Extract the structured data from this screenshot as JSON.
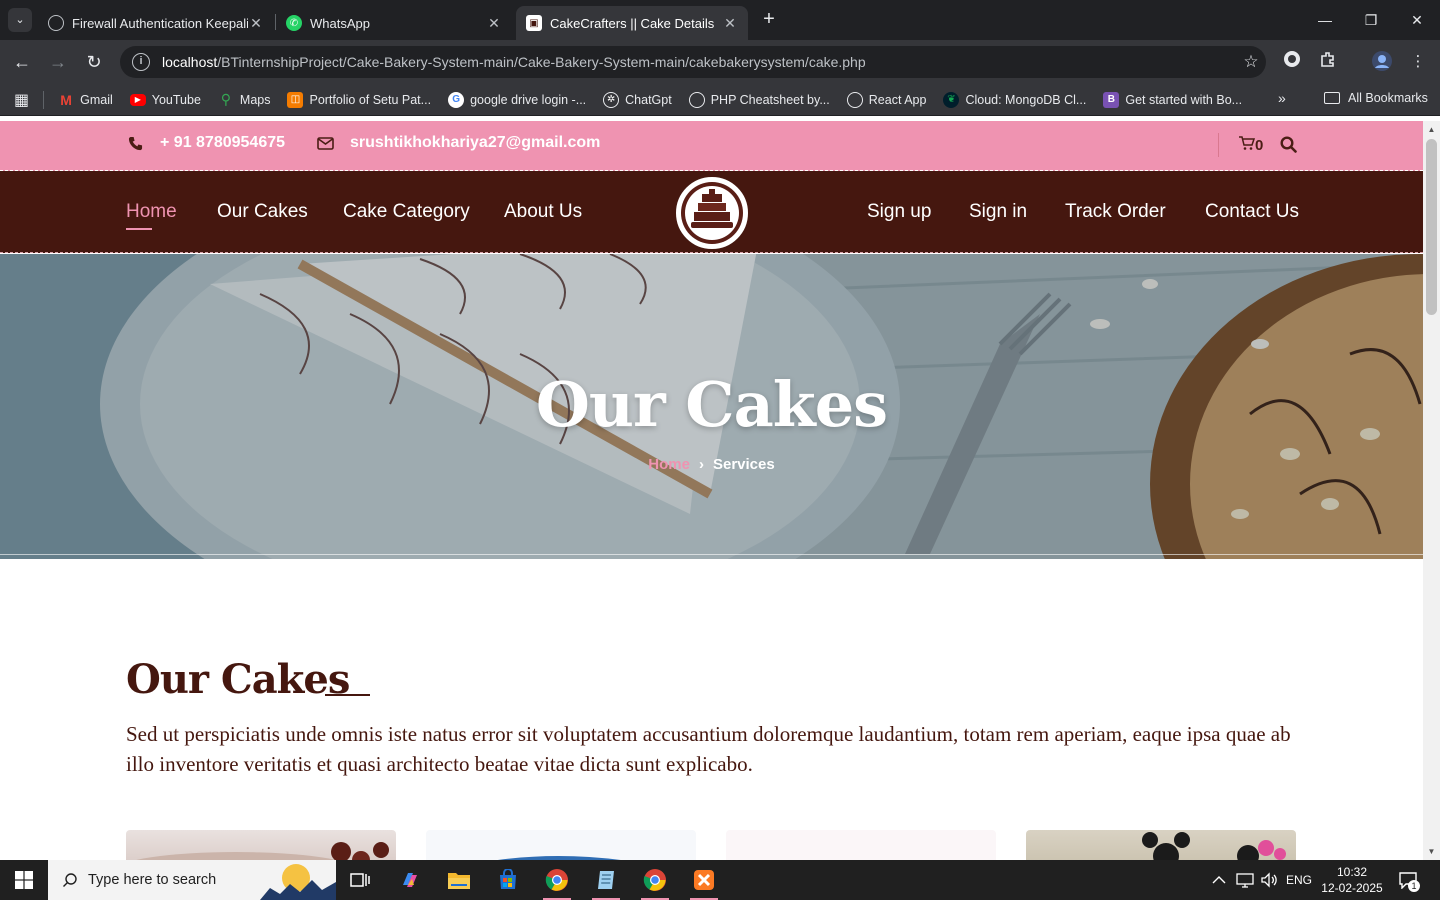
{
  "browser": {
    "tabs": [
      {
        "title": "Firewall Authentication Keepalive",
        "active": false
      },
      {
        "title": "WhatsApp",
        "active": false
      },
      {
        "title": "CakeCrafters || Cake Details",
        "active": true
      }
    ],
    "url_host": "localhost",
    "url_path": "/BTinternshipProject/Cake-Bakery-System-main/Cake-Bakery-System-main/cakebakerysystem/cake.php",
    "bookmarks": [
      {
        "label": "Gmail",
        "icon": "gmail-icon",
        "color": "#ea4335"
      },
      {
        "label": "YouTube",
        "icon": "youtube-icon",
        "color": "#ff0000"
      },
      {
        "label": "Maps",
        "icon": "maps-icon",
        "color": "#34a853"
      },
      {
        "label": "Portfolio of Setu Pat...",
        "icon": "portfolio-icon",
        "color": "#f57c00"
      },
      {
        "label": "google drive login -...",
        "icon": "google-icon",
        "color": "#4285f4"
      },
      {
        "label": "ChatGpt",
        "icon": "chatgpt-icon",
        "color": "#202124"
      },
      {
        "label": "PHP Cheatsheet by...",
        "icon": "globe-icon",
        "color": "#5f6368"
      },
      {
        "label": "React App",
        "icon": "globe-icon",
        "color": "#5f6368"
      },
      {
        "label": "Cloud: MongoDB Cl...",
        "icon": "mongodb-icon",
        "color": "#13aa52"
      },
      {
        "label": "Get started with Bo...",
        "icon": "bootstrap-icon",
        "color": "#7952b3"
      }
    ],
    "all_bookmarks_label": "All Bookmarks"
  },
  "topbar": {
    "phone": "+ 91 8780954675",
    "email": "srushtikhokhariya27@gmail.com",
    "cart_count": "0"
  },
  "nav": {
    "left": [
      "Home",
      "Our Cakes",
      "Cake Category",
      "About Us"
    ],
    "right": [
      "Sign up",
      "Sign in",
      "Track Order",
      "Contact Us"
    ],
    "active": "Home"
  },
  "hero": {
    "title": "Our Cakes",
    "breadcrumb_home": "Home",
    "breadcrumb_separator": "›",
    "breadcrumb_current": "Services"
  },
  "section": {
    "title": "Our Cakes",
    "description": "Sed ut perspiciatis unde omnis iste natus error sit voluptatem accusantium doloremque laudantium, totam rem aperiam, eaque ipsa quae ab illo inventore veritatis et quasi architecto beatae vitae dicta sunt explicabo."
  },
  "taskbar": {
    "search_placeholder": "Type here to search",
    "language": "ENG",
    "time": "10:32",
    "date": "12-02-2025",
    "notification_count": "1"
  },
  "colors": {
    "pink": "#ef93b1",
    "brown": "#45170f"
  }
}
